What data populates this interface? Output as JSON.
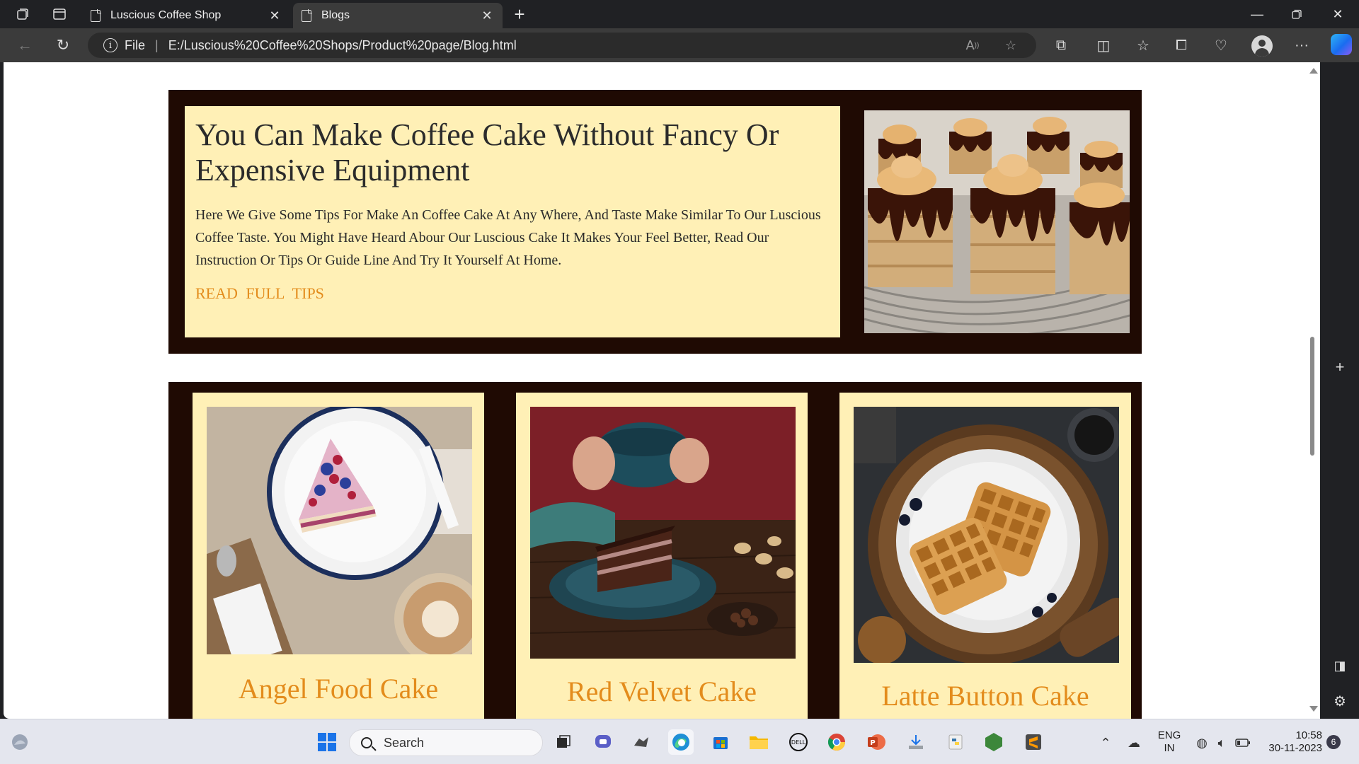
{
  "browser": {
    "tabs": [
      {
        "title": "Luscious Coffee Shop",
        "active": false
      },
      {
        "title": "Blogs",
        "active": true
      }
    ],
    "address": {
      "scheme_label": "File",
      "url": "E:/Luscious%20Coffee%20Shops/Product%20page/Blog.html"
    }
  },
  "page": {
    "hero": {
      "title": "You Can Make Coffee Cake Without Fancy Or Expensive Equipment",
      "body": "Here We Give Some Tips For Make An Coffee Cake At Any Where, And Taste Make Similar To Our Luscious Coffee Taste. You Might Have Heard Abour Our Luscious Cake It Makes Your Feel Better, Read Our Instruction Or Tips Or Guide Line And Try It Yourself At Home.",
      "link": "READ FULL TIPS"
    },
    "cards": [
      {
        "title": "Angel Food Cake"
      },
      {
        "title": "Red Velvet Cake"
      },
      {
        "title": "Latte Button Cake"
      }
    ]
  },
  "taskbar": {
    "search_placeholder": "Search",
    "language": "ENG",
    "region": "IN",
    "time": "10:58",
    "date": "30-11-2023",
    "notification_count": "6"
  },
  "colors": {
    "frame_dark": "#1f0a03",
    "panel_cream": "#fff0b6",
    "accent_orange": "#e38c1c"
  }
}
